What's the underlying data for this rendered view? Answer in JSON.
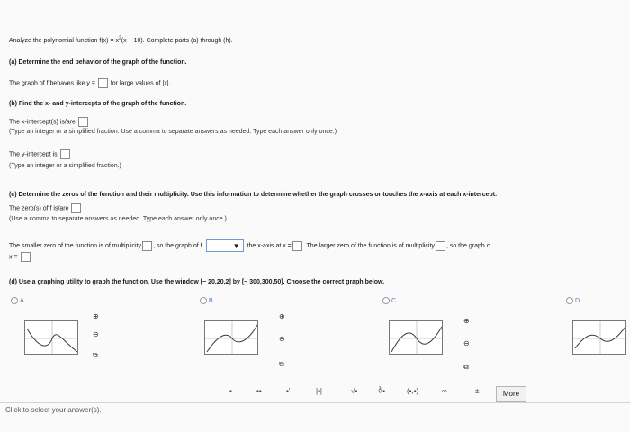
{
  "problem": {
    "title_prefix": "Analyze the polynomial function f(x) = x",
    "title_exp": "2",
    "title_suffix": "(x − 10). Complete parts (a) through (h)."
  },
  "part_a": {
    "heading": "(a) Determine the end behavior of the graph of the function.",
    "prompt_before": "The graph of f behaves like y =",
    "prompt_after": "for large values of |x|."
  },
  "part_b": {
    "heading": "(b) Find the x- and y-intercepts of the graph of the function.",
    "x_prompt": "The x-intercept(s) is/are",
    "x_hint": "(Type an integer or a simplified fraction. Use a comma to separate answers as needed. Type each answer only once.)",
    "y_prompt": "The y-intercept is",
    "y_hint": "(Type an integer or a simplified fraction.)"
  },
  "part_c": {
    "heading": "(c) Determine the zeros of the function and their multiplicity. Use this information to determine whether the graph crosses or touches the x-axis at each x-intercept.",
    "zeros_prompt": "The zero(s) of f is/are",
    "zeros_hint": "(Use a comma to separate answers as needed. Type each answer only once.)",
    "smaller_1": "The smaller zero of the function is of multiplicity",
    "smaller_2": ", so the graph of f",
    "smaller_3": "the x-axis at x =",
    "larger_1": ". The larger zero of the function is of multiplicity",
    "larger_2": ", so the graph c",
    "x_eq": "x ="
  },
  "part_d": {
    "heading": "(d) Use a graphing utility to graph the function. Use the window [− 20,20,2] by [− 300,300,50]. Choose the correct graph below.",
    "options": [
      {
        "label": "A."
      },
      {
        "label": "B."
      },
      {
        "label": "C."
      },
      {
        "label": "D."
      }
    ]
  },
  "toolbar": {
    "tools": [
      "▪",
      "▪▪",
      "▪'",
      "|▪|",
      "√▪",
      "∛▪",
      "(▪,▪)",
      "∞",
      "±"
    ],
    "more_label": "More"
  },
  "status_text": "Click to select your answer(s)."
}
